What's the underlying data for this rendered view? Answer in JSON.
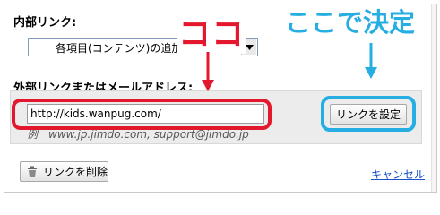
{
  "internal_link": {
    "label": "内部リンク:",
    "selected_option": "各項目(コンテンツ)の追加・削除"
  },
  "external_link": {
    "label": "外部リンクまたはメールアドレス:",
    "url_value": "http://kids.wanpug.com/",
    "example": "例　www.jp.jimdo.com, support@jimdo.jp",
    "set_button_label": "リンクを設定"
  },
  "footer": {
    "delete_button_label": "リンクを削除",
    "cancel_label": "キャンセル"
  },
  "annotations": {
    "red_text": "ココ",
    "blue_text": "ここで決定",
    "red_color": "#e3172d",
    "blue_color": "#26aee3"
  },
  "icons": {
    "dropdown": "chevron-down-icon",
    "delete": "trash-icon",
    "arrow": "arrow-down-icon"
  }
}
